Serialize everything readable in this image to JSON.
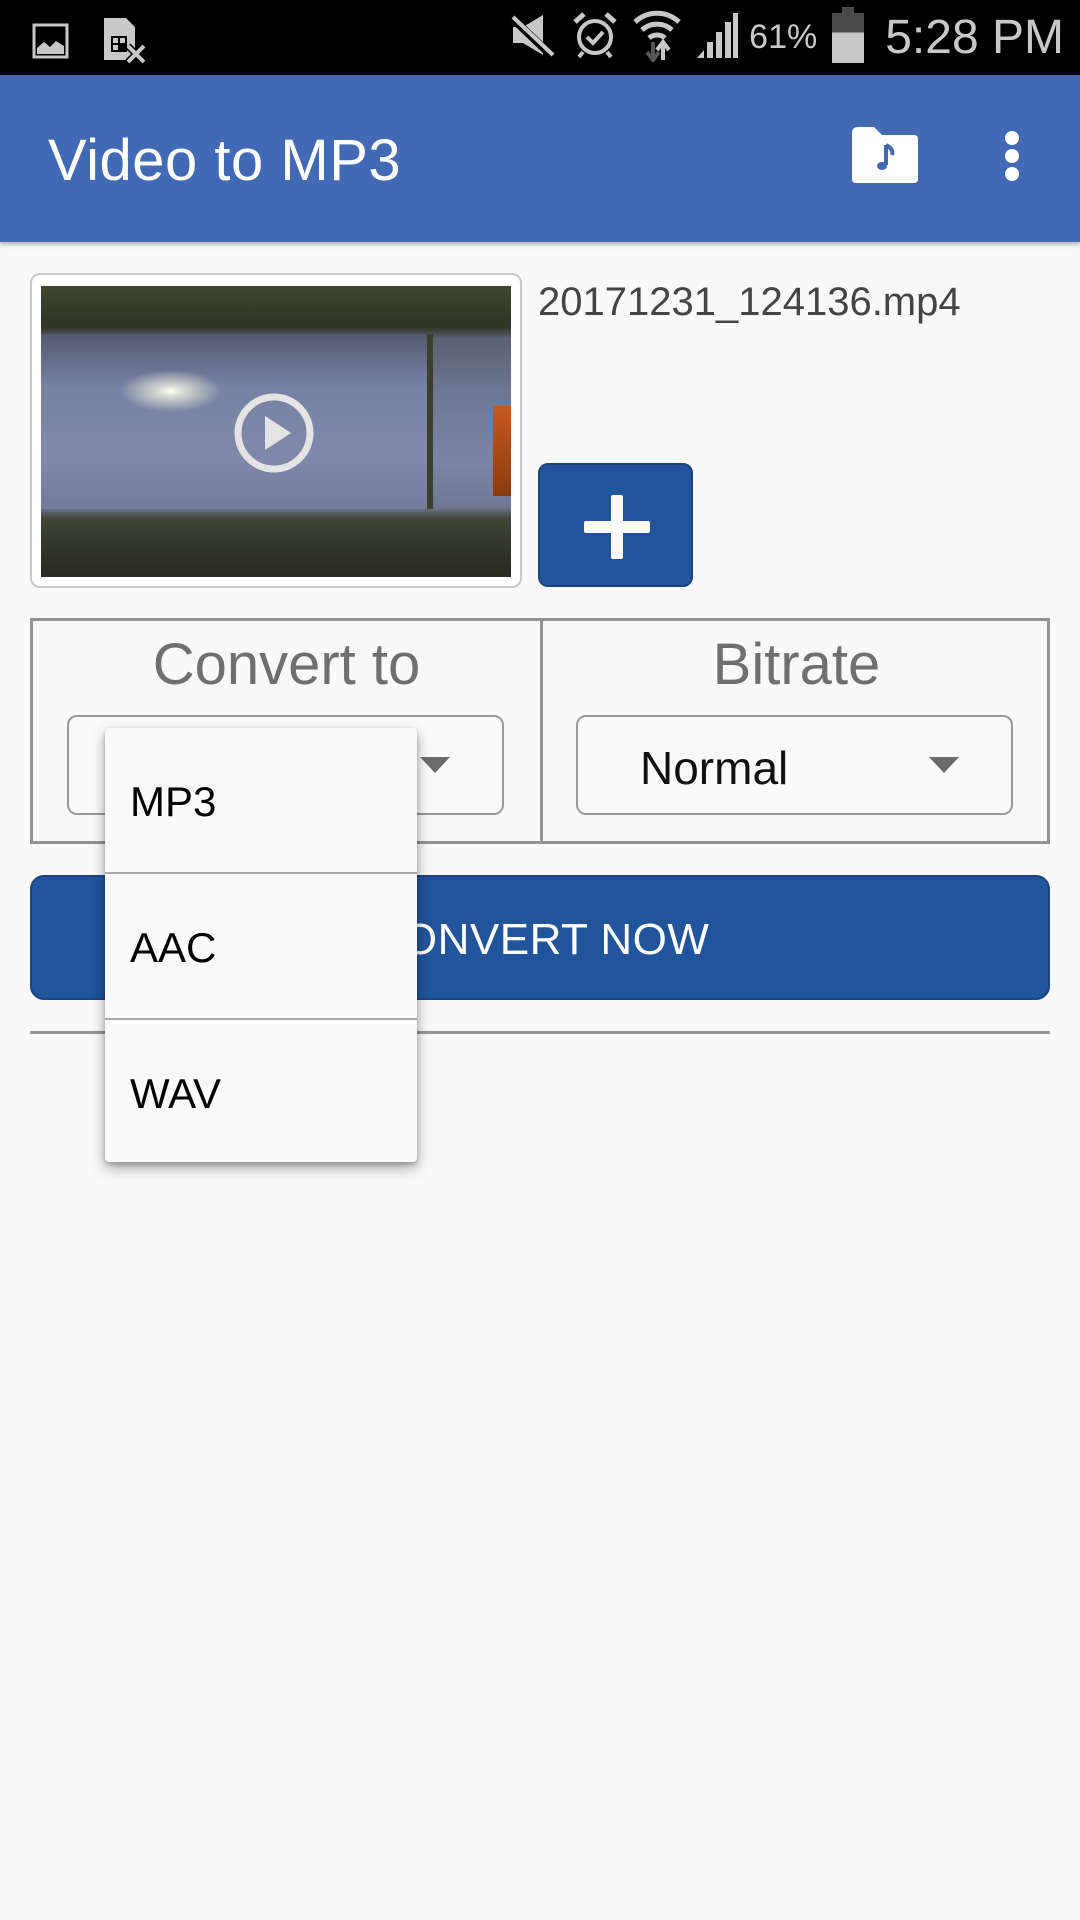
{
  "status_bar": {
    "left_icons": [
      "gallery-icon",
      "sim-card-missing-icon"
    ],
    "right_icons": [
      "mute-icon",
      "alarm-icon",
      "wifi-data-icon",
      "signal-icon",
      "battery-icon"
    ],
    "battery_percent": "61%",
    "battery_level": 0.61,
    "time": "5:28 PM"
  },
  "app_bar": {
    "title": "Video to MP3",
    "actions": [
      "music-folder-icon",
      "overflow-menu-icon"
    ]
  },
  "video": {
    "file_name": "20171231_124136.mp4",
    "thumbnail_overlay": "play-icon",
    "add_button_icon": "plus-icon"
  },
  "options": {
    "convert_to": {
      "label": "Convert to",
      "selected": "",
      "options": [
        "MP3",
        "AAC",
        "WAV"
      ],
      "open": true
    },
    "bitrate": {
      "label": "Bitrate",
      "selected": "Normal"
    }
  },
  "convert_button": {
    "label": "CONVERT NOW"
  },
  "colors": {
    "app_bar": "#4169b4",
    "primary_button": "#22549b",
    "background": "#f9f9f9"
  }
}
